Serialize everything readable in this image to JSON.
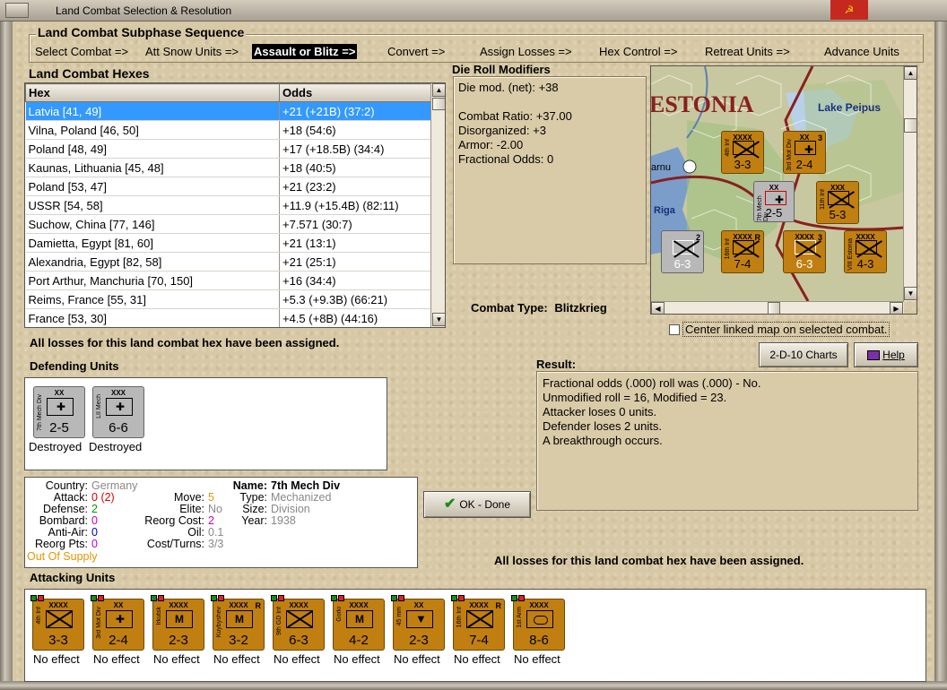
{
  "window": {
    "title": "Land Combat Selection & Resolution",
    "close_glyph": "☭"
  },
  "phase": {
    "header": "Land Combat Subphase Sequence",
    "steps": [
      "Select Combat =>",
      "Att Snow Units =>",
      "Assault or Blitz =>",
      "Convert =>",
      "Assign Losses =>",
      "Hex Control =>",
      "Retreat Units =>",
      "Advance Units"
    ]
  },
  "hexes": {
    "header": "Land Combat Hexes",
    "col_hex": "Hex",
    "col_odds": "Odds",
    "rows": [
      {
        "hex": "Latvia [41, 49]",
        "odds": "+21 (+21B) (37:2)"
      },
      {
        "hex": "Vilna, Poland [46, 50]",
        "odds": "+18 (54:6)"
      },
      {
        "hex": "Poland [48, 49]",
        "odds": "+17 (+18.5B) (34:4)"
      },
      {
        "hex": "Kaunas, Lithuania [45, 48]",
        "odds": "+18 (40:5)"
      },
      {
        "hex": "Poland [53, 47]",
        "odds": "+21 (23:2)"
      },
      {
        "hex": "USSR [54, 58]",
        "odds": "+11.9 (+15.4B) (82:11)"
      },
      {
        "hex": "Suchow, China [77, 146]",
        "odds": "+7.571 (30:7)"
      },
      {
        "hex": "Damietta, Egypt [81, 60]",
        "odds": "+21 (13:1)"
      },
      {
        "hex": "Alexandria, Egypt [82, 58]",
        "odds": "+21 (25:1)"
      },
      {
        "hex": "Port Arthur, Manchuria [70, 150]",
        "odds": "+16 (34:4)"
      },
      {
        "hex": "Reims, France [55, 31]",
        "odds": "+5.3 (+9.3B) (66:21)"
      },
      {
        "hex": "France [53, 30]",
        "odds": "+4.5 (+8B) (44:16)"
      }
    ]
  },
  "modifiers": {
    "header": "Die Roll Modifiers",
    "lines": [
      "Die mod. (net): +38",
      "",
      "Combat Ratio: +37.00",
      "Disorganized: +3",
      "Armor: -2.00",
      "Fractional Odds: 0"
    ]
  },
  "combat_type": {
    "label": "Combat Type:",
    "value": "Blitzkrieg"
  },
  "map": {
    "labels": [
      "ESTONIA",
      "Lake Peipus",
      "arnu",
      "Riga"
    ],
    "center_checkbox": "Center linked map on selected combat.",
    "counters": [
      {
        "tag": "4th Inf",
        "size": "XXXX",
        "val": "3-3"
      },
      {
        "tag": "3rd Mot Div",
        "size": "XX",
        "val": "2-4",
        "rmark": "3"
      },
      {
        "tag": "7th Mech Div",
        "size": "XX",
        "val": "2-5"
      },
      {
        "tag": "11th Inf",
        "size": "XXX",
        "val": "5-3"
      },
      {
        "tag": "",
        "size": "",
        "val": "6-3",
        "rmark": "2"
      },
      {
        "tag": "16th Inf",
        "size": "XXXX",
        "val": "7-4",
        "rmark": "R"
      },
      {
        "tag": "",
        "size": "XXXX",
        "val": "6-3",
        "rmark": "3"
      },
      {
        "tag": "VIII Estonia",
        "size": "XXXX",
        "val": "4-3"
      }
    ]
  },
  "losses_msg": "All losses for this land combat hex have been assigned.",
  "buttons": {
    "charts": "2-D-10 Charts",
    "help": "Help",
    "ok": "OK - Done"
  },
  "result": {
    "header": "Result:",
    "lines": [
      "Fractional odds (.000) roll was (.000)  -  No.",
      "Unmodified roll = 16, Modified = 23.",
      "Attacker loses 0 units.",
      "Defender loses 2 units.",
      "A breakthrough occurs."
    ]
  },
  "defenders": {
    "header": "Defending Units",
    "units": [
      {
        "tag": "7th Mech Div",
        "size": "XX",
        "val": "2-5",
        "status": "Destroyed"
      },
      {
        "tag": "LII Mech",
        "size": "XXX",
        "val": "6-6",
        "status": "Destroyed"
      }
    ]
  },
  "unit_info": {
    "country_label": "Country:",
    "country": "Germany",
    "attack_label": "Attack:",
    "attack": "0",
    "attack_extra": "(2)",
    "defense_label": "Defense:",
    "defense": "2",
    "bombard_label": "Bombard:",
    "bombard": "0",
    "antiair_label": "Anti-Air:",
    "antiair": "0",
    "reorg_label": "Reorg Pts:",
    "reorg": "0",
    "supply": "Out Of Supply",
    "move_label": "Move:",
    "move": "5",
    "elite_label": "Elite:",
    "elite": "No",
    "reorgcost_label": "Reorg Cost:",
    "reorgcost": "2",
    "oil_label": "Oil:",
    "oil": "0.1",
    "costturns_label": "Cost/Turns:",
    "costturns": "3/3",
    "name_label": "Name:",
    "name": "7th Mech Div",
    "type_label": "Type:",
    "type": "Mechanized",
    "size_label": "Size:",
    "size": "Division",
    "year_label": "Year:",
    "year": "1938"
  },
  "attackers": {
    "header": "Attacking Units",
    "units": [
      {
        "tag": "4th Inf",
        "size": "XXXX",
        "val": "3-3",
        "sym": "inf",
        "status": "No effect"
      },
      {
        "tag": "3rd Mot Div",
        "size": "XX",
        "val": "2-4",
        "sym": "mech",
        "status": "No effect"
      },
      {
        "tag": "Irkutsk",
        "size": "XXXX",
        "val": "2-3",
        "sym": "mtn",
        "status": "No effect"
      },
      {
        "tag": "Kuybyshev",
        "size": "XXXX",
        "val": "3-2",
        "sym": "mtn",
        "rmark": "R",
        "status": "No effect"
      },
      {
        "tag": "9th GD Inf",
        "size": "XXXX",
        "val": "6-3",
        "sym": "inf",
        "status": "No effect"
      },
      {
        "tag": "Gorki",
        "size": "XXXX",
        "val": "4-2",
        "sym": "mtn",
        "status": "No effect"
      },
      {
        "tag": "45 mm",
        "size": "XX",
        "val": "2-3",
        "sym": "at",
        "status": "No effect"
      },
      {
        "tag": "16th Inf",
        "size": "XXXX",
        "val": "7-4",
        "sym": "inf",
        "rmark": "R",
        "status": "No effect"
      },
      {
        "tag": "1st Arm",
        "size": "XXXX",
        "val": "8-6",
        "sym": "arm",
        "status": "No effect"
      }
    ]
  },
  "colors": {
    "selection": "#3399ff",
    "counter_tan": "#c07f10",
    "counter_grey": "#b8b8b8"
  }
}
